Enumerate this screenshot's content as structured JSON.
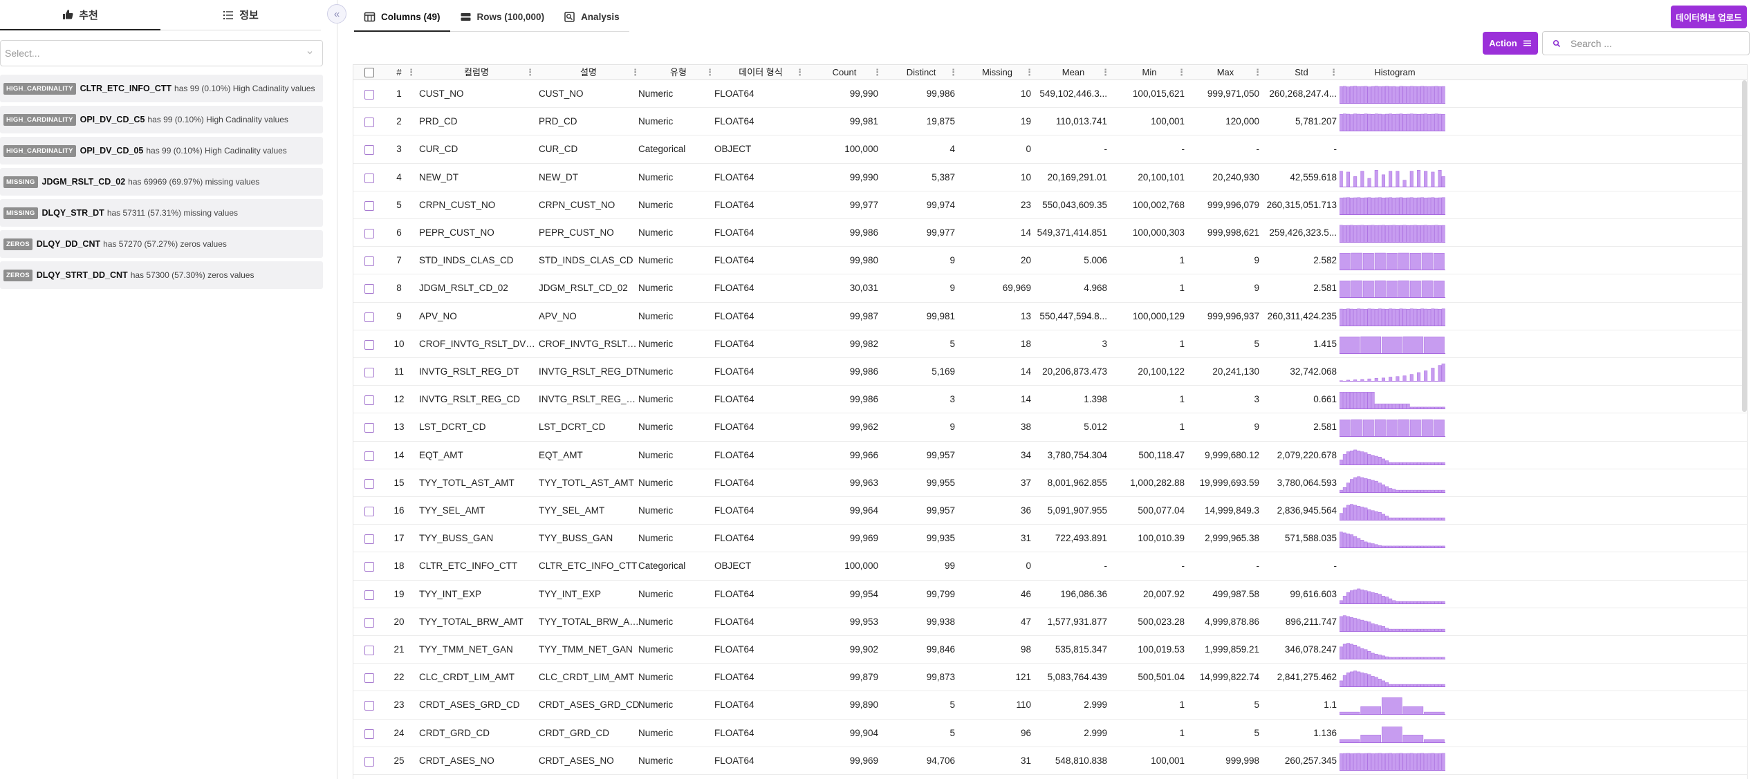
{
  "left_panel": {
    "tabs": [
      {
        "label": "추천",
        "icon": "thumbs-up-icon"
      },
      {
        "label": "정보",
        "icon": "list-icon"
      }
    ],
    "select_placeholder": "Select...",
    "insights": [
      {
        "badge": "HIGH_CARDINALITY",
        "column": "CLTR_ETC_INFO_CTT",
        "text": "has 99 (0.10%) High Cadinality values"
      },
      {
        "badge": "HIGH_CARDINALITY",
        "column": "OPI_DV_CD_C5",
        "text": "has 99 (0.10%) High Cadinality values"
      },
      {
        "badge": "HIGH_CARDINALITY",
        "column": "OPI_DV_CD_05",
        "text": "has 99 (0.10%) High Cadinality values"
      },
      {
        "badge": "MISSING",
        "column": "JDGM_RSLT_CD_02",
        "text": "has 69969 (69.97%) missing values"
      },
      {
        "badge": "MISSING",
        "column": "DLQY_STR_DT",
        "text": "has 57311 (57.31%) missing values"
      },
      {
        "badge": "ZEROS",
        "column": "DLQY_DD_CNT",
        "text": "has 57270 (57.27%) zeros values"
      },
      {
        "badge": "ZEROS",
        "column": "DLQY_STRT_DD_CNT",
        "text": "has 57300 (57.30%) zeros values"
      }
    ]
  },
  "collapse_label": "«",
  "main_tabs": [
    {
      "label": "Columns (49)",
      "icon": "table-icon"
    },
    {
      "label": "Rows (100,000)",
      "icon": "rows-icon"
    },
    {
      "label": "Analysis",
      "icon": "analysis-icon"
    }
  ],
  "upload_label": "데이터허브 업로드",
  "action_label": "Action",
  "search_placeholder": "Search ...",
  "accent_color": "#9b30d9",
  "histogram_color": "#c79cf0",
  "table": {
    "headers": [
      "#",
      "컬럼명",
      "설명",
      "유형",
      "데이터 형식",
      "Count",
      "Distinct",
      "Missing",
      "Mean",
      "Min",
      "Max",
      "Std",
      "Histogram"
    ],
    "rows": [
      {
        "num": "1",
        "name": "CUST_NO",
        "desc": "CUST_NO",
        "type": "Numeric",
        "format": "FLOAT64",
        "count": "99,990",
        "distinct": "99,986",
        "missing": "10",
        "mean": "549,102,446.3...",
        "min": "100,015,621",
        "max": "999,971,050",
        "std": "260,268,247.4...",
        "hist": [
          0.95,
          0.97,
          0.94,
          0.96,
          0.98,
          0.95,
          0.96,
          0.97,
          0.94,
          0.96,
          0.98,
          0.95,
          0.96,
          0.97,
          0.95,
          0.96,
          0.94,
          0.97,
          0.96,
          0.95,
          0.97,
          0.96,
          0.95,
          0.97,
          0.96,
          0.95,
          0.96,
          0.97,
          0.95,
          0.96
        ]
      },
      {
        "num": "2",
        "name": "PRD_CD",
        "desc": "PRD_CD",
        "type": "Numeric",
        "format": "FLOAT64",
        "count": "99,981",
        "distinct": "19,875",
        "missing": "19",
        "mean": "110,013.741",
        "min": "100,001",
        "max": "120,000",
        "std": "5,781.207",
        "hist": [
          0.95,
          0.97,
          0.96,
          0.94,
          0.97,
          0.96,
          0.95,
          0.97,
          0.96,
          0.95,
          0.97,
          0.96,
          0.94,
          0.96,
          0.97,
          0.95,
          0.96,
          0.97,
          0.95,
          0.96,
          0.97,
          0.96,
          0.95,
          0.96,
          0.97,
          0.95,
          0.96,
          0.97,
          0.96,
          0.95
        ]
      },
      {
        "num": "3",
        "name": "CUR_CD",
        "desc": "CUR_CD",
        "type": "Categorical",
        "format": "OBJECT",
        "count": "100,000",
        "distinct": "4",
        "missing": "0",
        "mean": "-",
        "min": "-",
        "max": "-",
        "std": "-",
        "hist": []
      },
      {
        "num": "4",
        "name": "NEW_DT",
        "desc": "NEW_DT",
        "type": "Numeric",
        "format": "FLOAT64",
        "count": "99,990",
        "distinct": "5,387",
        "missing": "10",
        "mean": "20,169,291.01",
        "min": "20,100,101",
        "max": "20,240,930",
        "std": "42,559.618",
        "hist": [
          0.9,
          0,
          0.85,
          0,
          0.6,
          0,
          0.9,
          0,
          0.5,
          0,
          0.95,
          0,
          0.7,
          0,
          0.9,
          0,
          0.9,
          0,
          0.4,
          0,
          0.9,
          0,
          0.95,
          0,
          0.9,
          0,
          0.85,
          0,
          0.95,
          0.6
        ]
      },
      {
        "num": "5",
        "name": "CRPN_CUST_NO",
        "desc": "CRPN_CUST_NO",
        "type": "Numeric",
        "format": "FLOAT64",
        "count": "99,977",
        "distinct": "99,974",
        "missing": "23",
        "mean": "550,043,609.35",
        "min": "100,002,768",
        "max": "999,996,079",
        "std": "260,315,051.713",
        "hist": [
          0.95,
          0.96,
          0.97,
          0.95,
          0.96,
          0.97,
          0.95,
          0.96,
          0.97,
          0.95,
          0.96,
          0.97,
          0.95,
          0.96,
          0.97,
          0.95,
          0.96,
          0.97,
          0.95,
          0.96,
          0.97,
          0.95,
          0.96,
          0.97,
          0.95,
          0.96,
          0.97,
          0.95,
          0.96,
          0.97
        ]
      },
      {
        "num": "6",
        "name": "PEPR_CUST_NO",
        "desc": "PEPR_CUST_NO",
        "type": "Numeric",
        "format": "FLOAT64",
        "count": "99,986",
        "distinct": "99,977",
        "missing": "14",
        "mean": "549,371,414.851",
        "min": "100,000,303",
        "max": "999,998,621",
        "std": "259,426,323.5...",
        "hist": [
          0.97,
          0.95,
          0.96,
          0.97,
          0.95,
          0.96,
          0.97,
          0.95,
          0.96,
          0.97,
          0.95,
          0.96,
          0.97,
          0.95,
          0.96,
          0.97,
          0.95,
          0.96,
          0.97,
          0.95,
          0.96,
          0.97,
          0.95,
          0.96,
          0.97,
          0.95,
          0.96,
          0.97,
          0.95,
          0.96
        ]
      },
      {
        "num": "7",
        "name": "STD_INDS_CLAS_CD",
        "desc": "STD_INDS_CLAS_CD",
        "type": "Numeric",
        "format": "FLOAT64",
        "count": "99,980",
        "distinct": "9",
        "missing": "20",
        "mean": "5.006",
        "min": "1",
        "max": "9",
        "std": "2.582",
        "hist": [
          0.95,
          0.96,
          0.95,
          0.96,
          0.95,
          0.96,
          0.95,
          0.96,
          0.95
        ]
      },
      {
        "num": "8",
        "name": "JDGM_RSLT_CD_02",
        "desc": "JDGM_RSLT_CD_02",
        "type": "Numeric",
        "format": "FLOAT64",
        "count": "30,031",
        "distinct": "9",
        "missing": "69,969",
        "mean": "4.968",
        "min": "1",
        "max": "9",
        "std": "2.581",
        "hist": [
          0.95,
          0.96,
          0.95,
          0.96,
          0.95,
          0.96,
          0.95,
          0.96,
          0.95
        ]
      },
      {
        "num": "9",
        "name": "APV_NO",
        "desc": "APV_NO",
        "type": "Numeric",
        "format": "FLOAT64",
        "count": "99,987",
        "distinct": "99,981",
        "missing": "13",
        "mean": "550,447,594.8...",
        "min": "100,000,129",
        "max": "999,996,937",
        "std": "260,311,424.235",
        "hist": [
          0.96,
          0.95,
          0.97,
          0.96,
          0.95,
          0.97,
          0.96,
          0.95,
          0.97,
          0.96,
          0.95,
          0.97,
          0.96,
          0.95,
          0.97,
          0.96,
          0.95,
          0.97,
          0.96,
          0.95,
          0.97,
          0.96,
          0.95,
          0.97,
          0.96,
          0.95,
          0.97,
          0.96,
          0.95,
          0.97
        ]
      },
      {
        "num": "10",
        "name": "CROF_INVTG_RSLT_DV_...",
        "desc": "CROF_INVTG_RSLT_D...",
        "type": "Numeric",
        "format": "FLOAT64",
        "count": "99,982",
        "distinct": "5",
        "missing": "18",
        "mean": "3",
        "min": "1",
        "max": "5",
        "std": "1.415",
        "hist": [
          0.95,
          0.96,
          0.95,
          0.96,
          0.95
        ]
      },
      {
        "num": "11",
        "name": "INVTG_RSLT_REG_DT",
        "desc": "INVTG_RSLT_REG_DT",
        "type": "Numeric",
        "format": "FLOAT64",
        "count": "99,986",
        "distinct": "5,169",
        "missing": "14",
        "mean": "20,206,873.473",
        "min": "20,100,122",
        "max": "20,241,130",
        "std": "32,742.068",
        "hist": [
          0.05,
          0,
          0.08,
          0,
          0.1,
          0,
          0.12,
          0,
          0.15,
          0,
          0.18,
          0,
          0.2,
          0,
          0.25,
          0,
          0.28,
          0,
          0.32,
          0,
          0.4,
          0,
          0.5,
          0,
          0.6,
          0,
          0.75,
          0,
          0.9,
          1.0
        ]
      },
      {
        "num": "12",
        "name": "INVTG_RSLT_REG_CD",
        "desc": "INVTG_RSLT_REG_CD",
        "type": "Numeric",
        "format": "FLOAT64",
        "count": "99,986",
        "distinct": "3",
        "missing": "14",
        "mean": "1.398",
        "min": "1",
        "max": "3",
        "std": "0.661",
        "hist": [
          0.95,
          0.95,
          0.95,
          0.95,
          0.95,
          0.95,
          0.95,
          0.95,
          0.95,
          0.95,
          0.3,
          0.3,
          0.3,
          0.3,
          0.3,
          0.3,
          0.3,
          0.3,
          0.3,
          0.3,
          0.12,
          0.12,
          0.12,
          0.12,
          0.12,
          0.12,
          0.12,
          0.12,
          0.12,
          0.12
        ]
      },
      {
        "num": "13",
        "name": "LST_DCRT_CD",
        "desc": "LST_DCRT_CD",
        "type": "Numeric",
        "format": "FLOAT64",
        "count": "99,962",
        "distinct": "9",
        "missing": "38",
        "mean": "5.012",
        "min": "1",
        "max": "9",
        "std": "2.581",
        "hist": [
          0.95,
          0.96,
          0.95,
          0.96,
          0.95,
          0.96,
          0.95,
          0.96,
          0.95
        ]
      },
      {
        "num": "14",
        "name": "EQT_AMT",
        "desc": "EQT_AMT",
        "type": "Numeric",
        "format": "FLOAT64",
        "count": "99,966",
        "distinct": "99,957",
        "missing": "34",
        "mean": "3,780,754.304",
        "min": "500,118.47",
        "max": "9,999,680.12",
        "std": "2,079,220.678",
        "hist": [
          0.3,
          0.6,
          0.75,
          0.8,
          0.85,
          0.8,
          0.75,
          0.7,
          0.6,
          0.55,
          0.5,
          0.45,
          0.35,
          0.25,
          0.15,
          0.15,
          0.15,
          0.15,
          0.15,
          0.15,
          0.15,
          0.15,
          0.15,
          0.15,
          0.15,
          0.15,
          0.15,
          0.15,
          0.15,
          0.15
        ]
      },
      {
        "num": "15",
        "name": "TYY_TOTL_AST_AMT",
        "desc": "TYY_TOTL_AST_AMT",
        "type": "Numeric",
        "format": "FLOAT64",
        "count": "99,963",
        "distinct": "99,955",
        "missing": "37",
        "mean": "8,001,962.855",
        "min": "1,000,282.88",
        "max": "19,999,693.59",
        "std": "3,780,064.593",
        "hist": [
          0.15,
          0.3,
          0.55,
          0.75,
          0.85,
          0.9,
          0.85,
          0.8,
          0.75,
          0.7,
          0.65,
          0.55,
          0.45,
          0.35,
          0.25,
          0.2,
          0.15,
          0.15,
          0.15,
          0.15,
          0.15,
          0.15,
          0.15,
          0.15,
          0.15,
          0.15,
          0.15,
          0.15,
          0.15,
          0.15
        ]
      },
      {
        "num": "16",
        "name": "TYY_SEL_AMT",
        "desc": "TYY_SEL_AMT",
        "type": "Numeric",
        "format": "FLOAT64",
        "count": "99,964",
        "distinct": "99,957",
        "missing": "36",
        "mean": "5,091,907.955",
        "min": "500,077.04",
        "max": "14,999,849.3",
        "std": "2,836,945.564",
        "hist": [
          0.4,
          0.7,
          0.85,
          0.9,
          0.85,
          0.8,
          0.75,
          0.7,
          0.6,
          0.55,
          0.5,
          0.45,
          0.35,
          0.25,
          0.15,
          0.15,
          0.15,
          0.15,
          0.15,
          0.15,
          0.15,
          0.15,
          0.15,
          0.15,
          0.15,
          0.15,
          0.15,
          0.15,
          0.15,
          0.15
        ]
      },
      {
        "num": "17",
        "name": "TYY_BUSS_GAN",
        "desc": "TYY_BUSS_GAN",
        "type": "Numeric",
        "format": "FLOAT64",
        "count": "99,969",
        "distinct": "99,935",
        "missing": "31",
        "mean": "722,493.891",
        "min": "100,010.39",
        "max": "2,999,965.38",
        "std": "571,588.035",
        "hist": [
          0.9,
          0.85,
          0.8,
          0.75,
          0.65,
          0.55,
          0.45,
          0.35,
          0.3,
          0.25,
          0.2,
          0.15,
          0.12,
          0.12,
          0.12,
          0.12,
          0.12,
          0.12,
          0.12,
          0.12,
          0.12,
          0.12,
          0.12,
          0.12,
          0.12,
          0.12,
          0.12,
          0.12,
          0.12,
          0.12
        ]
      },
      {
        "num": "18",
        "name": "CLTR_ETC_INFO_CTT",
        "desc": "CLTR_ETC_INFO_CTT",
        "type": "Categorical",
        "format": "OBJECT",
        "count": "100,000",
        "distinct": "99",
        "missing": "0",
        "mean": "-",
        "min": "-",
        "max": "-",
        "std": "-",
        "hist": []
      },
      {
        "num": "19",
        "name": "TYY_INT_EXP",
        "desc": "TYY_INT_EXP",
        "type": "Numeric",
        "format": "FLOAT64",
        "count": "99,954",
        "distinct": "99,799",
        "missing": "46",
        "mean": "196,086.36",
        "min": "20,007.92",
        "max": "499,987.58",
        "std": "99,616.603",
        "hist": [
          0.2,
          0.45,
          0.65,
          0.75,
          0.8,
          0.85,
          0.8,
          0.75,
          0.7,
          0.65,
          0.6,
          0.55,
          0.45,
          0.4,
          0.3,
          0.2,
          0.15,
          0.15,
          0.15,
          0.15,
          0.15,
          0.15,
          0.15,
          0.15,
          0.15,
          0.15,
          0.15,
          0.15,
          0.15,
          0.15
        ]
      },
      {
        "num": "20",
        "name": "TYY_TOTAL_BRW_AMT",
        "desc": "TYY_TOTAL_BRW_AMT",
        "type": "Numeric",
        "format": "FLOAT64",
        "count": "99,953",
        "distinct": "99,938",
        "missing": "47",
        "mean": "1,577,931.877",
        "min": "500,023.28",
        "max": "4,999,878.86",
        "std": "896,211.747",
        "hist": [
          0.85,
          0.9,
          0.85,
          0.8,
          0.75,
          0.7,
          0.65,
          0.6,
          0.55,
          0.45,
          0.4,
          0.35,
          0.3,
          0.2,
          0.15,
          0.15,
          0.15,
          0.15,
          0.15,
          0.15,
          0.15,
          0.15,
          0.15,
          0.15,
          0.15,
          0.15,
          0.15,
          0.15,
          0.15,
          0.15
        ]
      },
      {
        "num": "21",
        "name": "TYY_TMM_NET_GAN",
        "desc": "TYY_TMM_NET_GAN",
        "type": "Numeric",
        "format": "FLOAT64",
        "count": "99,902",
        "distinct": "99,846",
        "missing": "98",
        "mean": "535,815.347",
        "min": "100,019.53",
        "max": "1,999,859.21",
        "std": "346,078.247",
        "hist": [
          0.7,
          0.85,
          0.9,
          0.85,
          0.8,
          0.7,
          0.6,
          0.55,
          0.45,
          0.35,
          0.3,
          0.25,
          0.2,
          0.15,
          0.12,
          0.12,
          0.12,
          0.12,
          0.12,
          0.12,
          0.12,
          0.12,
          0.12,
          0.12,
          0.12,
          0.12,
          0.12,
          0.12,
          0.12,
          0.12
        ]
      },
      {
        "num": "22",
        "name": "CLC_CRDT_LIM_AMT",
        "desc": "CLC_CRDT_LIM_AMT",
        "type": "Numeric",
        "format": "FLOAT64",
        "count": "99,879",
        "distinct": "99,873",
        "missing": "121",
        "mean": "5,083,764.439",
        "min": "500,501.04",
        "max": "14,999,822.74",
        "std": "2,841,275.462",
        "hist": [
          0.35,
          0.65,
          0.8,
          0.85,
          0.9,
          0.85,
          0.8,
          0.75,
          0.7,
          0.6,
          0.55,
          0.45,
          0.35,
          0.25,
          0.15,
          0.15,
          0.15,
          0.15,
          0.15,
          0.15,
          0.15,
          0.15,
          0.15,
          0.15,
          0.15,
          0.15,
          0.15,
          0.15,
          0.15,
          0.15
        ]
      },
      {
        "num": "23",
        "name": "CRDT_ASES_GRD_CD",
        "desc": "CRDT_ASES_GRD_CD",
        "type": "Numeric",
        "format": "FLOAT64",
        "count": "99,890",
        "distinct": "5",
        "missing": "110",
        "mean": "2.999",
        "min": "1",
        "max": "5",
        "std": "1.1",
        "hist": [
          0.15,
          0.45,
          0.95,
          0.45,
          0.15
        ]
      },
      {
        "num": "24",
        "name": "CRDT_GRD_CD",
        "desc": "CRDT_GRD_CD",
        "type": "Numeric",
        "format": "FLOAT64",
        "count": "99,904",
        "distinct": "5",
        "missing": "96",
        "mean": "2.999",
        "min": "1",
        "max": "5",
        "std": "1.136",
        "hist": [
          0.2,
          0.45,
          0.9,
          0.45,
          0.2
        ]
      },
      {
        "num": "25",
        "name": "CRDT_ASES_NO",
        "desc": "CRDT_ASES_NO",
        "type": "Numeric",
        "format": "FLOAT64",
        "count": "99,969",
        "distinct": "94,706",
        "missing": "31",
        "mean": "548,810.838",
        "min": "100,001",
        "max": "999,998",
        "std": "260,257.345",
        "hist": [
          0.95,
          0.96,
          0.97,
          0.95,
          0.96,
          0.97,
          0.95,
          0.96,
          0.97,
          0.95,
          0.96,
          0.97,
          0.95,
          0.96,
          0.97,
          0.95,
          0.96,
          0.97,
          0.95,
          0.96,
          0.97,
          0.95,
          0.96,
          0.97,
          0.95,
          0.96,
          0.97,
          0.95,
          0.96,
          0.97
        ]
      }
    ]
  }
}
